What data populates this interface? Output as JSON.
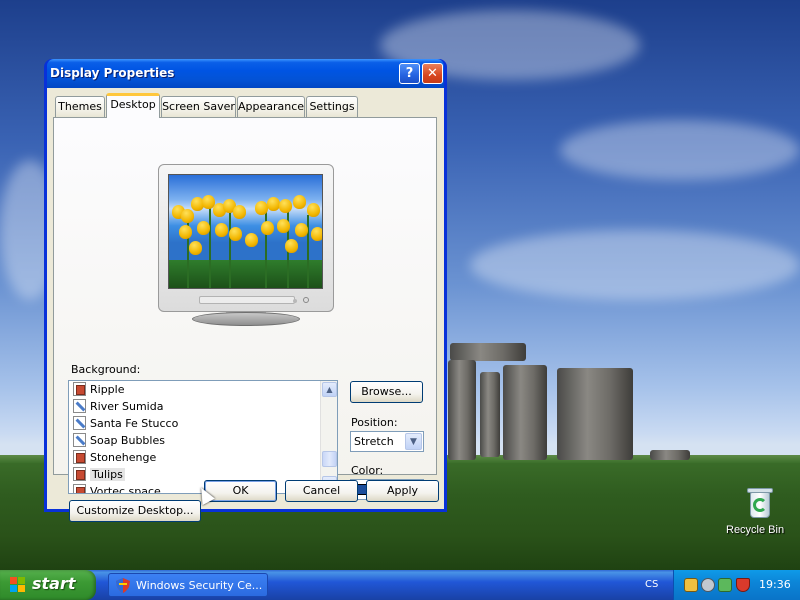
{
  "desktop": {
    "recycle_bin_label": "Recycle Bin"
  },
  "window": {
    "title": "Display Properties",
    "help_glyph": "?",
    "close_glyph": "✕",
    "tabs": [
      {
        "label": "Themes",
        "active": false
      },
      {
        "label": "Desktop",
        "active": true
      },
      {
        "label": "Screen Saver",
        "active": false
      },
      {
        "label": "Appearance",
        "active": false
      },
      {
        "label": "Settings",
        "active": false
      }
    ],
    "background_label": "Background:",
    "background_items": [
      {
        "label": "Ripple",
        "icon": "picture-icon"
      },
      {
        "label": "River Sumida",
        "icon": "paint-icon"
      },
      {
        "label": "Santa Fe Stucco",
        "icon": "paint-icon"
      },
      {
        "label": "Soap Bubbles",
        "icon": "paint-icon"
      },
      {
        "label": "Stonehenge",
        "icon": "picture-icon"
      },
      {
        "label": "Tulips",
        "icon": "picture-icon",
        "selected": true
      },
      {
        "label": "Vortec space",
        "icon": "picture-icon"
      }
    ],
    "browse_label": "Browse...",
    "position_label": "Position:",
    "position_value": "Stretch",
    "color_label": "Color:",
    "color_value": "#1c4e9c",
    "customize_label": "Customize Desktop...",
    "ok_label": "OK",
    "cancel_label": "Cancel",
    "apply_label": "Apply"
  },
  "taskbar": {
    "start_label": "start",
    "task_button_label": "Windows Security Ce...",
    "language": "CS",
    "clock": "19:36"
  },
  "colors": {
    "titlebar": "#0054e3",
    "dialog_face": "#ece9d8",
    "taskbar": "#2157d7",
    "start_button": "#3c9a34",
    "tray": "#0c86d8"
  }
}
